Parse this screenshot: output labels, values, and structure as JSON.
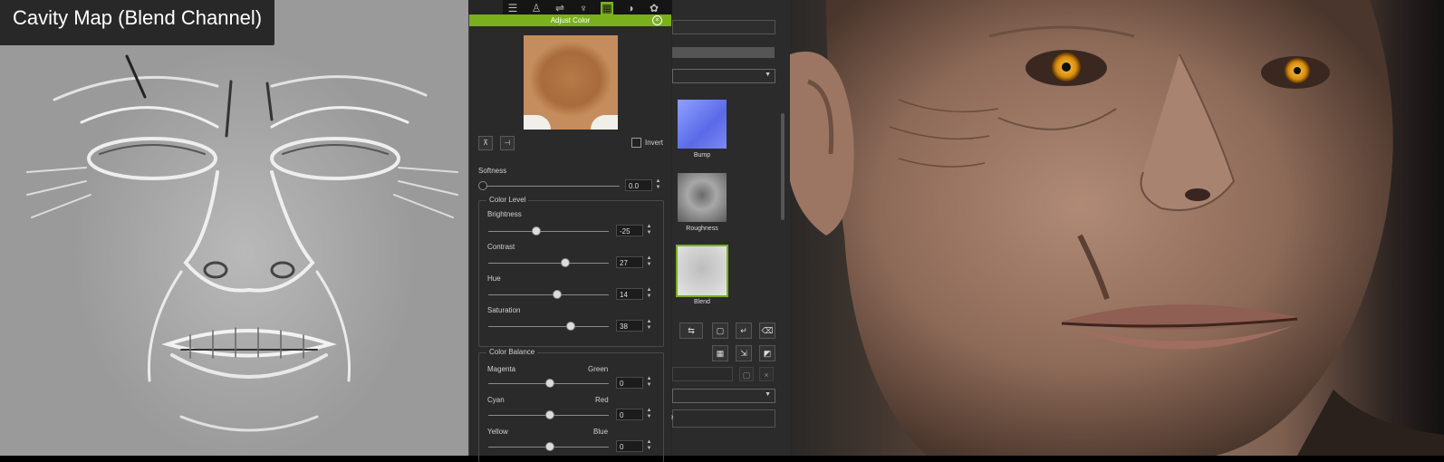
{
  "cavity_view": {
    "title": "Cavity Map (Blend Channel)"
  },
  "adjust_color": {
    "title": "Adjust Color",
    "invert_label": "Invert",
    "softness": {
      "label": "Softness",
      "value": "0.0",
      "level": 0.0
    },
    "color_level": {
      "title": "Color Level",
      "brightness": {
        "label": "Brightness",
        "value": "-25",
        "level": 0.38
      },
      "contrast": {
        "label": "Contrast",
        "value": "27",
        "level": 0.63
      },
      "hue": {
        "label": "Hue",
        "value": "14",
        "level": 0.57
      },
      "saturation": {
        "label": "Saturation",
        "value": "38",
        "level": 0.69
      }
    },
    "color_balance": {
      "title": "Color Balance",
      "magenta_green": {
        "left": "Magenta",
        "right": "Green",
        "value": "0",
        "level": 0.5
      },
      "cyan_red": {
        "left": "Cyan",
        "right": "Red",
        "value": "0",
        "level": 0.5
      },
      "yellow_blue": {
        "left": "Yellow",
        "right": "Blue",
        "value": "0",
        "level": 0.5
      }
    }
  },
  "texture_channels": {
    "items": [
      {
        "label": "Bump",
        "icon": "normal-map-thumbnail",
        "color": "#6f7ff0"
      },
      {
        "label": "Roughness",
        "icon": "roughness-map-thumbnail",
        "color": "#8a8a8a"
      },
      {
        "label": "Blend",
        "icon": "blend-map-thumbnail",
        "color": "#c9c9c9",
        "selected": true
      }
    ],
    "partial_field_text": "e"
  },
  "colors": {
    "accent": "#7ab01c",
    "panel": "#2a2a2a"
  }
}
